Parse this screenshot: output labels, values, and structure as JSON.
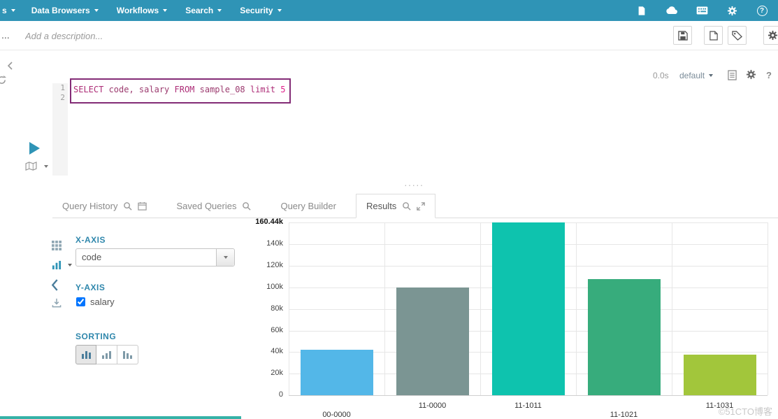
{
  "topnav": {
    "items": [
      {
        "label": "s"
      },
      {
        "label": "Data Browsers"
      },
      {
        "label": "Workflows"
      },
      {
        "label": "Search"
      },
      {
        "label": "Security"
      }
    ],
    "help_glyph": "?"
  },
  "header": {
    "title_ellipsis": "...",
    "description_placeholder": "Add a description..."
  },
  "editor": {
    "line_numbers": [
      "1",
      "2"
    ],
    "query_tokens": [
      {
        "text": "SELECT ",
        "type": "keyword"
      },
      {
        "text": "code, salary ",
        "type": "plain"
      },
      {
        "text": "FROM ",
        "type": "keyword"
      },
      {
        "text": "sample_08 ",
        "type": "plain"
      },
      {
        "text": "limit ",
        "type": "keyword"
      },
      {
        "text": "5",
        "type": "number"
      }
    ],
    "exec_time": "0.0s",
    "database": "default"
  },
  "tabs": [
    {
      "label": "Query History"
    },
    {
      "label": "Saved Queries"
    },
    {
      "label": "Query Builder"
    },
    {
      "label": "Results"
    }
  ],
  "chart_panel": {
    "x_axis_heading": "X-AXIS",
    "x_axis_value": "code",
    "y_axis_heading": "Y-AXIS",
    "y_series": [
      {
        "name": "salary",
        "checked": true
      }
    ],
    "sorting_heading": "SORTING"
  },
  "chart_data": {
    "type": "bar",
    "categories": [
      "00-0000",
      "11-0000",
      "11-1011",
      "11-1021",
      "11-1031"
    ],
    "series": [
      {
        "name": "salary",
        "values": [
          42270,
          100310,
          160440,
          107970,
          37980
        ]
      }
    ],
    "xlabel": "code",
    "ylabel": "salary",
    "ylim": [
      0,
      160440
    ],
    "yticks": [
      {
        "value": 160440,
        "label": "160.44k"
      },
      {
        "value": 140000,
        "label": "140k"
      },
      {
        "value": 120000,
        "label": "120k"
      },
      {
        "value": 100000,
        "label": "100k"
      },
      {
        "value": 80000,
        "label": "80k"
      },
      {
        "value": 60000,
        "label": "60k"
      },
      {
        "value": 40000,
        "label": "40k"
      },
      {
        "value": 20000,
        "label": "20k"
      },
      {
        "value": 0,
        "label": "0"
      }
    ],
    "bar_colors": [
      "#53b7e8",
      "#7b9593",
      "#0ec3ae",
      "#37ac7c",
      "#a2c63b"
    ],
    "grid": true,
    "legend": "none",
    "label_rows": [
      1,
      0,
      0,
      1,
      0
    ]
  },
  "watermark": "©51CTO博客"
}
